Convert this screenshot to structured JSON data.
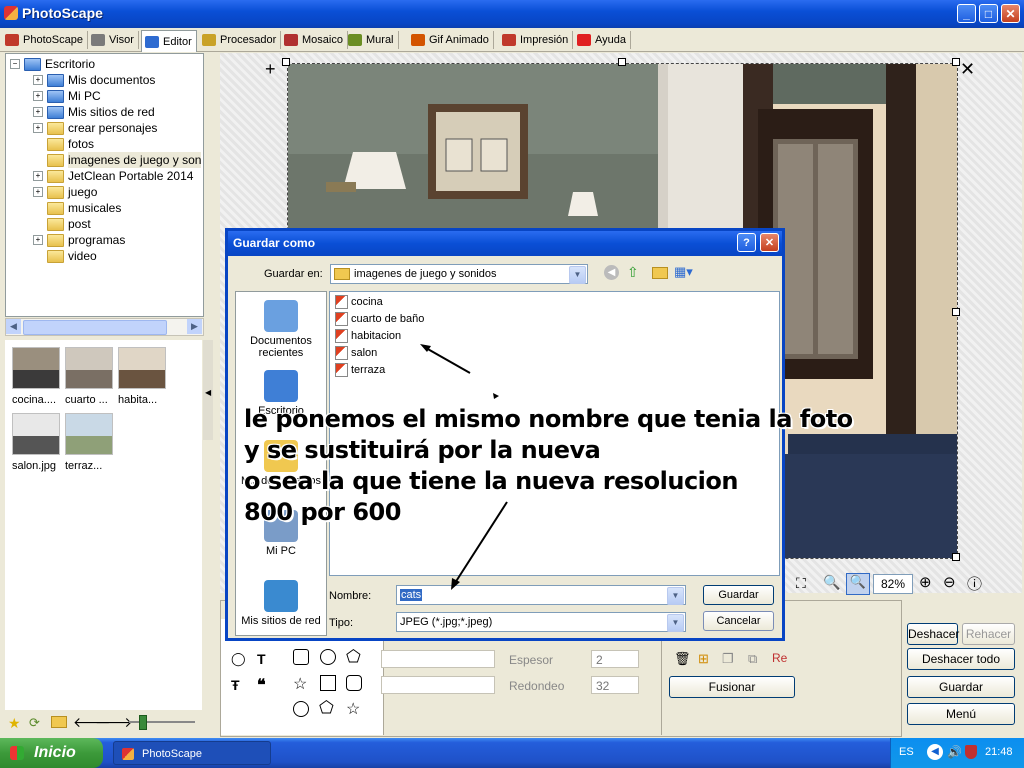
{
  "app": {
    "title": "PhotoScape",
    "minimize": "_",
    "maximize": "□",
    "close": "✕"
  },
  "tabs": [
    {
      "label": "PhotoScape",
      "icon": "photoscape-icon",
      "color": "#c0392b"
    },
    {
      "label": "Visor",
      "icon": "viewer-icon",
      "color": "#7a7a7a"
    },
    {
      "label": "Editor",
      "icon": "editor-icon",
      "color": "#2e6bd1"
    },
    {
      "label": "Procesador",
      "icon": "batch-icon",
      "color": "#c9a227"
    },
    {
      "label": "Mosaico",
      "icon": "mosaic-icon",
      "color": "#b03030"
    },
    {
      "label": "Mural",
      "icon": "mural-icon",
      "color": "#6b8e23"
    },
    {
      "label": "Gif Animado",
      "icon": "gif-icon",
      "color": "#d35400"
    },
    {
      "label": "Impresión",
      "icon": "print-icon",
      "color": "#c0392b"
    },
    {
      "label": "Ayuda",
      "icon": "help-icon",
      "color": "#e02020"
    }
  ],
  "tree": [
    {
      "label": "Escritorio",
      "expand": "−",
      "root": true
    },
    {
      "label": "Mis documentos",
      "expand": "+"
    },
    {
      "label": "Mi PC",
      "expand": "+"
    },
    {
      "label": "Mis sitios de red",
      "expand": "+"
    },
    {
      "label": "crear personajes",
      "expand": "+"
    },
    {
      "label": "fotos",
      "expand": ""
    },
    {
      "label": "imagenes de juego y son",
      "expand": "",
      "selected": true
    },
    {
      "label": "JetClean Portable 2014",
      "expand": "+"
    },
    {
      "label": "juego",
      "expand": "+"
    },
    {
      "label": "musicales",
      "expand": ""
    },
    {
      "label": "post",
      "expand": ""
    },
    {
      "label": "programas",
      "expand": "+"
    },
    {
      "label": "video",
      "expand": ""
    }
  ],
  "thumbnails": [
    "cocina....",
    "cuarto ...",
    "habita...",
    "salon.jpg",
    "terraz..."
  ],
  "zoom": "82%",
  "right_buttons": {
    "undo": "Deshacer",
    "redo": "Rehacer",
    "undo_all": "Deshacer todo",
    "save": "Guardar",
    "menu": "Menú"
  },
  "panel": {
    "thickness_label": "Espesor",
    "thickness_value": "2",
    "rounding_label": "Redondeo",
    "rounding_value": "32",
    "merge": "Fusionar"
  },
  "dialog": {
    "title": "Guardar como",
    "help": "?",
    "save_in_label": "Guardar en:",
    "save_in_value": "imagenes de juego y sonidos",
    "places": [
      "Documentos recientes",
      "Escritorio",
      "Mis documentos",
      "Mi PC",
      "Mis sitios de red"
    ],
    "files": [
      "cocina",
      "cuarto de baño",
      "habitacion",
      "salon",
      "terraza"
    ],
    "name_label": "Nombre:",
    "name_value": "cats",
    "type_label": "Tipo:",
    "type_value": "JPEG (*.jpg;*.jpeg)",
    "save_button": "Guardar",
    "cancel_button": "Cancelar"
  },
  "annotation": [
    "le ponemos el mismo nombre que tenia la foto",
    "y se sustituirá por la nueva",
    "o sea la que tiene la nueva resolucion",
    "800 por 600"
  ],
  "taskbar": {
    "start": "Inicio",
    "app": "PhotoScape",
    "lang": "ES",
    "time": "21:48"
  },
  "colors": {
    "xp_blue": "#0845c4",
    "taskbar": "#245edb",
    "start_green": "#3c9a3a"
  }
}
